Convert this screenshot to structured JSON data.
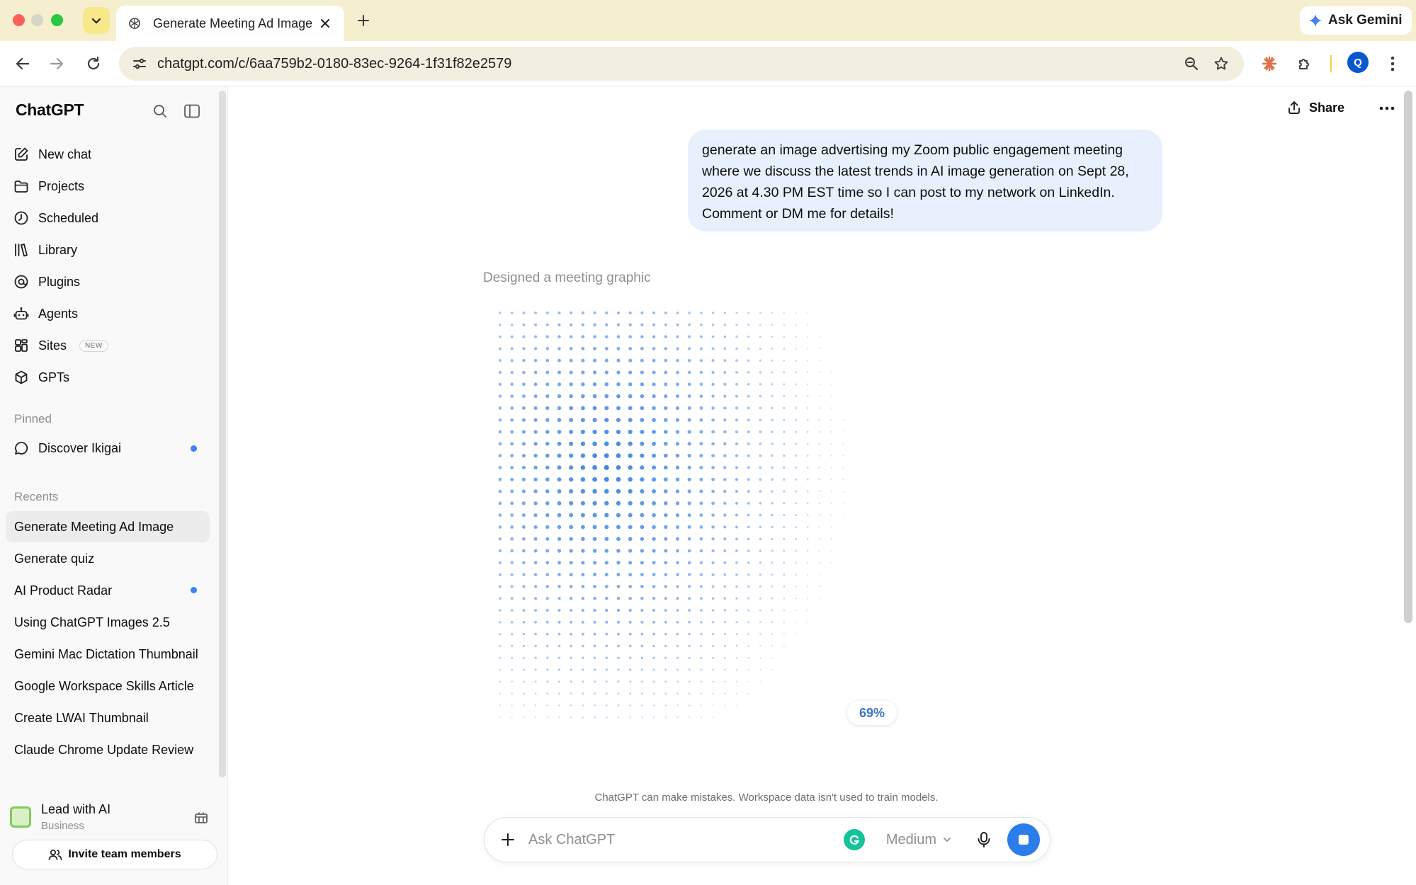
{
  "browser": {
    "tab_title": "Generate Meeting Ad Image",
    "ask_gemini": "Ask Gemini",
    "url": "chatgpt.com/c/6aa759b2-0180-83ec-9264-1f31f82e2579",
    "profile_initial": "Q"
  },
  "sidebar": {
    "brand": "ChatGPT",
    "nav": [
      {
        "label": "New chat",
        "icon": "edit-icon"
      },
      {
        "label": "Projects",
        "icon": "folder-icon"
      },
      {
        "label": "Scheduled",
        "icon": "clock-icon"
      },
      {
        "label": "Library",
        "icon": "library-icon"
      },
      {
        "label": "Plugins",
        "icon": "plugin-icon"
      },
      {
        "label": "Agents",
        "icon": "robot-icon"
      },
      {
        "label": "Sites",
        "icon": "grid-icon",
        "badge": "NEW"
      },
      {
        "label": "GPTs",
        "icon": "cube-icon"
      }
    ],
    "pinned_label": "Pinned",
    "pinned": [
      {
        "label": "Discover Ikigai",
        "unread": true
      }
    ],
    "recents_label": "Recents",
    "recents": [
      {
        "label": "Generate Meeting Ad Image",
        "active": true
      },
      {
        "label": "Generate quiz"
      },
      {
        "label": "AI Product Radar",
        "unread": true
      },
      {
        "label": "Using ChatGPT Images 2.5"
      },
      {
        "label": "Gemini Mac Dictation Thumbnail"
      },
      {
        "label": "Google Workspace Skills Article"
      },
      {
        "label": "Create LWAI Thumbnail"
      },
      {
        "label": "Claude Chrome Update Review"
      }
    ],
    "workspace": {
      "name": "Lead with AI",
      "plan": "Business"
    },
    "invite_label": "Invite team members"
  },
  "main": {
    "share_label": "Share",
    "user_message": "generate an image advertising my Zoom public engagement meeting where we discuss the latest trends in AI image generation on Sept 28, 2026 at 4.30 PM EST time so I can post to my network on LinkedIn. Comment or DM me for details!",
    "status": "Designed a meeting graphic",
    "progress_percent": 69,
    "progress_label": "69%",
    "disclaimer": "ChatGPT can make mistakes. Workspace data isn't used to train models.",
    "composer": {
      "placeholder": "Ask ChatGPT",
      "model": "Medium"
    }
  },
  "colors": {
    "accent": "#2b7de9",
    "dots": "#3f86e0",
    "unread": "#3b82f6"
  }
}
